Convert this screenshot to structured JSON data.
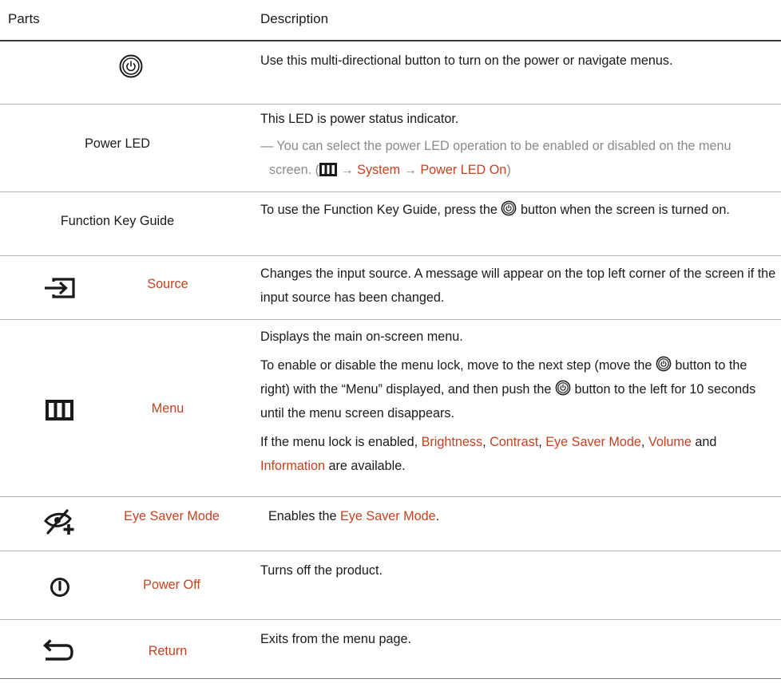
{
  "header": {
    "parts": "Parts",
    "description": "Description"
  },
  "colors": {
    "accent": "#c6411f",
    "note": "#8a8a8a",
    "text": "#1a1a1a"
  },
  "rows": {
    "jog": {
      "icon": "jog-button-icon",
      "desc1": "Use this multi-directional button to turn on the power or navigate menus."
    },
    "power_led": {
      "label": "Power LED",
      "desc1": "This LED is power status indicator.",
      "note_dash": "―",
      "note_text": "You can select the power LED operation to be enabled or disabled on the menu screen. (",
      "note_arrow1": "→",
      "note_system": "System",
      "note_arrow2": "→",
      "note_power_led_on": "Power LED On",
      "note_close": ")"
    },
    "function_key": {
      "label": "Function Key Guide",
      "desc_a": "To use the Function Key Guide, press the",
      "desc_b": "button when the screen is turned on."
    },
    "source": {
      "icon": "source-input-icon",
      "label": "Source",
      "desc1": "Changes the input source. A message will appear on the top left corner of the screen if the input source has been changed."
    },
    "menu": {
      "icon": "menu-icon",
      "label": "Menu",
      "desc1": "Displays the main on-screen menu.",
      "desc2_a": "To enable or disable the menu lock, move to the next step (move the",
      "desc2_b": "button to the right) with the “Menu” displayed, and then push the",
      "desc2_c": "button to the left for 10 seconds until the menu screen disappears.",
      "desc3_a": "If the menu lock is enabled,",
      "desc3_brightness": "Brightness",
      "desc3_comma1": ",",
      "desc3_contrast": "Contrast",
      "desc3_comma2": ",",
      "desc3_eye": "Eye Saver Mode",
      "desc3_comma3": ",",
      "desc3_volume": "Volume",
      "desc3_and": "and",
      "desc3_information": "Information",
      "desc3_end": "are available."
    },
    "eye_saver": {
      "icon": "eye-saver-icon",
      "label": "Eye Saver Mode",
      "desc_a": "Enables the",
      "desc_hl": "Eye Saver Mode",
      "desc_end": "."
    },
    "power_off": {
      "icon": "power-off-icon",
      "label": "Power Off",
      "desc1": "Turns off the product."
    },
    "return": {
      "icon": "return-icon",
      "label": "Return",
      "desc1": "Exits from the menu page."
    }
  }
}
